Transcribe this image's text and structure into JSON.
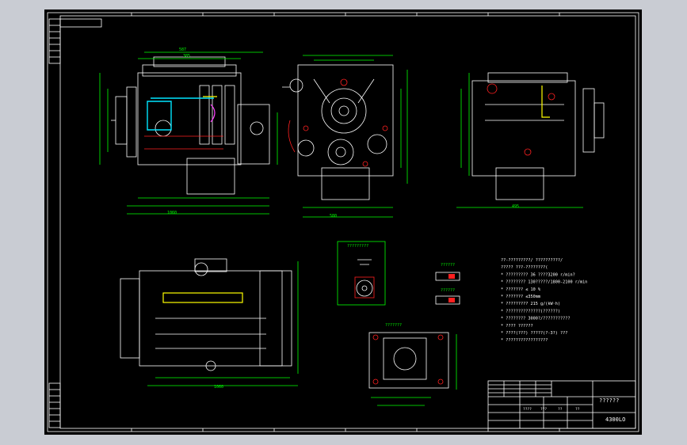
{
  "notes": {
    "lines": [
      "??-?????????/    ??????????/",
      "?????   ???-????????(",
      "* ????????? 36 ????3200 r/min?",
      "* ???????? 130?????/1800-2100 r/min",
      "* ???????  ≤ 10  %",
      "* ???????  ≤350mm",
      "* ????????? 215 g/(kW·h)",
      "* ??????????????(??????)",
      "* ????????  3000?/???????????",
      "* ????  ??????",
      "* ????(???) ?????(?-3?) ???",
      "* ?????????????????"
    ]
  },
  "callouts": {
    "detail_a_title": "?????????",
    "detail_b_title": "???????",
    "label_right_1": "??????",
    "label_right_2": "??????"
  },
  "titleblock": {
    "drawing_name": "??????",
    "drawing_code": "4300LO",
    "scale_row": [
      "????",
      "???",
      "??",
      "??"
    ]
  },
  "dims": {
    "front_total": "1060",
    "front_sub1": "587",
    "front_sub2": "385",
    "side_width": "580",
    "rear_total": "495",
    "top_total": "1060"
  }
}
